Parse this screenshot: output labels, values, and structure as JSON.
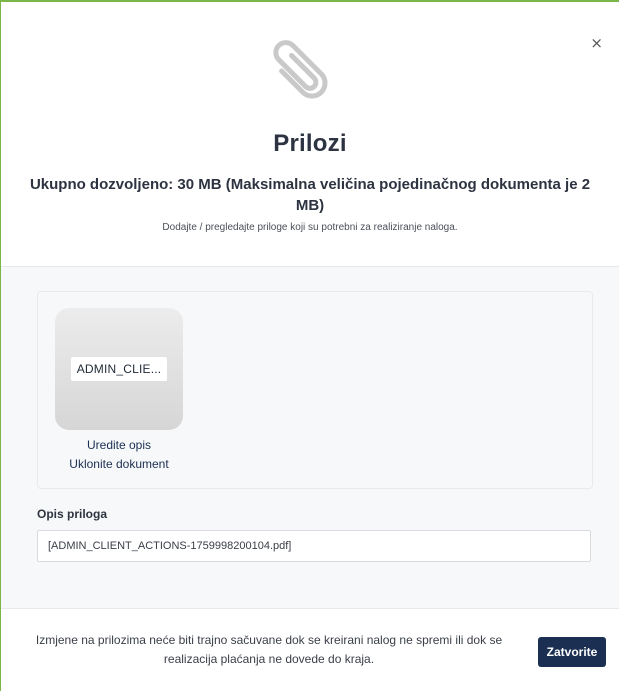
{
  "header": {
    "close_symbol": "×",
    "title": "Prilozi",
    "subtitle": "Ukupno dozvoljeno: 30 MB (Maksimalna veličina pojedinačnog dokumenta je 2 MB)",
    "description": "Dodajte / pregledajte priloge koji su potrebni za realiziranje naloga.",
    "icon": "paperclip-icon"
  },
  "attachment": {
    "thumbnail_label": "ADMIN_CLIE...",
    "edit_label": "Uredite opis",
    "remove_label": "Uklonite dokument"
  },
  "description_field": {
    "label": "Opis priloga",
    "value": "[ADMIN_CLIENT_ACTIONS-1759998200104.pdf]"
  },
  "footer": {
    "note": "Izmjene na prilozima neće biti trajno sačuvane dok se kreirani nalog ne spremi ili dok se realizacija plaćanja ne dovede do kraja.",
    "close_label": "Zatvorite"
  },
  "colors": {
    "primary": "#1b2f52",
    "accent_border": "#7ab648",
    "body_bg": "#f7f8f9"
  }
}
